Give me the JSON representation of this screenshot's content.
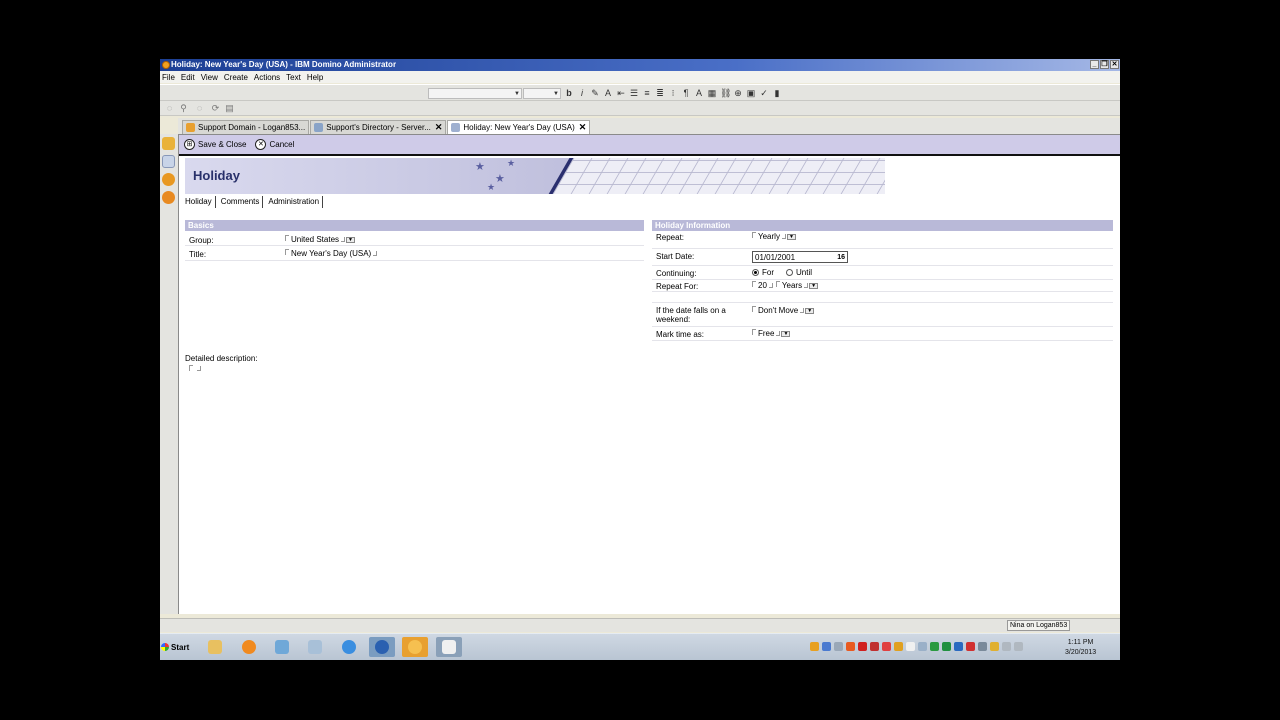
{
  "window": {
    "title": "Holiday: New Year's Day (USA) - IBM Domino Administrator"
  },
  "menu": [
    "File",
    "Edit",
    "View",
    "Create",
    "Actions",
    "Text",
    "Help"
  ],
  "format_toolbar": {
    "bold": "b",
    "italic": "i"
  },
  "tabs": [
    {
      "label": "Support Domain - Logan853...",
      "icon_color": "#e8a030"
    },
    {
      "label": "Support's Directory - Server...",
      "icon_color": "#8aa4c8",
      "close": "✕"
    },
    {
      "label": "Holiday: New Year's Day (USA)",
      "icon_color": "#9fb0d0",
      "close": "✕"
    }
  ],
  "actions": {
    "save_close": "Save & Close",
    "cancel": "Cancel"
  },
  "banner": {
    "title": "Holiday"
  },
  "form_tabs": [
    "Holiday",
    "Comments",
    "Administration"
  ],
  "basics": {
    "header": "Basics",
    "group_label": "Group:",
    "group_value": "United States",
    "title_label": "Title:",
    "title_value": "New Year's Day (USA)"
  },
  "holiday_info": {
    "header": "Holiday Information",
    "repeat_label": "Repeat:",
    "repeat_value": "Yearly",
    "start_date_label": "Start Date:",
    "start_date_value": "01/01/2001",
    "calendar_button": "16",
    "continuing_label": "Continuing:",
    "continuing_options": [
      "For",
      "Until"
    ],
    "continuing_selected": "For",
    "repeat_for_label": "Repeat  For:",
    "repeat_for_count": "20",
    "repeat_for_unit": "Years",
    "weekend_label": "If the date falls on a weekend:",
    "weekend_value": "Don't Move",
    "mark_time_label": "Mark time as:",
    "mark_time_value": "Free"
  },
  "detailed_description_label": "Detailed description:",
  "status": {
    "user": "Nina on Logan853"
  },
  "taskbar": {
    "start": "Start",
    "clock_time": "1:11 PM",
    "clock_date": "3/20/2013"
  }
}
